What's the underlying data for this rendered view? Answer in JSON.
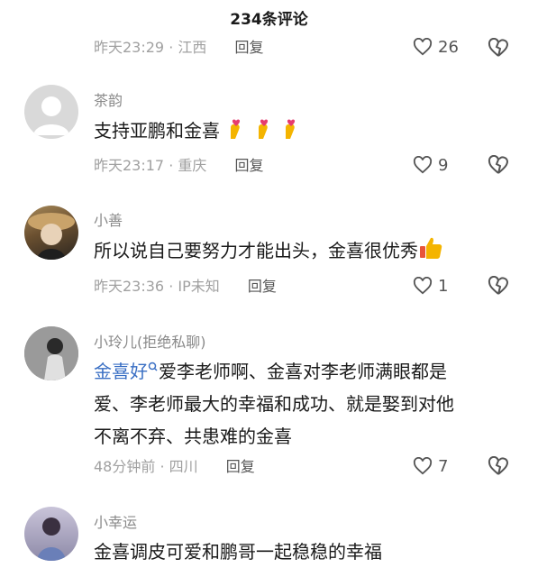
{
  "header": {
    "title": "234条评论"
  },
  "top_row": {
    "time": "昨天23:29",
    "sep": "·",
    "location": "江西",
    "reply": "回复",
    "likes": "26"
  },
  "comments": [
    {
      "name": "茶韵",
      "text": "支持亚鹏和金喜",
      "emoji": [
        "finger-heart-icon",
        "finger-heart-icon",
        "finger-heart-icon"
      ],
      "time": "昨天23:17",
      "sep": "·",
      "location": "重庆",
      "reply": "回复",
      "likes": "9"
    },
    {
      "name": "小善",
      "text": "所以说自己要努力才能出头，金喜很优秀",
      "emoji": [
        "thumbs-up-icon"
      ],
      "time": "昨天23:36",
      "sep": "·",
      "location": "IP未知",
      "reply": "回复",
      "likes": "1"
    },
    {
      "name": "小玲儿(拒绝私聊)",
      "mention": "金喜好",
      "line1": "爱李老师啊、金喜对李老师满眼都是",
      "line2": "爱、李老师最大的幸福和成功、就是娶到对他",
      "line3": "不离不弃、共患难的金喜",
      "time": "48分钟前",
      "sep": "·",
      "location": "四川",
      "reply": "回复",
      "likes": "7"
    },
    {
      "name": "小幸运",
      "text": "金喜调皮可爱和鹏哥一起稳稳的幸福"
    }
  ],
  "colors": {
    "mention": "#3a6fc4",
    "meta": "#a0a0a0",
    "name": "#8a8a8a",
    "heart_emoji": "#e63b6f",
    "hand": "#f4b400"
  }
}
